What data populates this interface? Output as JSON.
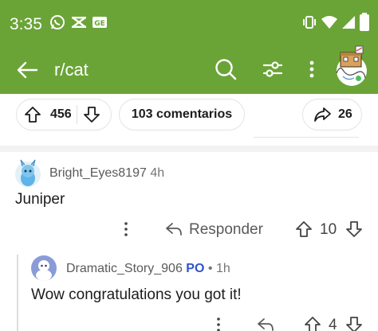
{
  "status_bar": {
    "time": "3:35",
    "icons": [
      "whatsapp-icon",
      "capcut-icon",
      "ge-badge-icon",
      "vibrate-icon",
      "wifi-icon",
      "signal-icon",
      "battery-icon"
    ]
  },
  "app_bar": {
    "title": "r/cat",
    "icons": [
      "back-arrow-icon",
      "search-icon",
      "filter-icon",
      "more-vertical-icon",
      "avatar"
    ]
  },
  "actions": {
    "upvotes": "456",
    "comments": "103 comentarios",
    "shares": "26"
  },
  "comments": [
    {
      "username": "Bright_Eyes8197",
      "age": "4h",
      "body": "Juniper",
      "reply_label": "Responder",
      "votes": "10"
    },
    {
      "username": "Dramatic_Story_906",
      "badge": "PO",
      "separator": "•",
      "age": "1h",
      "body": "Wow congratulations you got it!",
      "votes": "4"
    }
  ],
  "colors": {
    "brand_green": "#6aa436",
    "online_green": "#4cc160",
    "op_badge_blue": "#2f55c9",
    "text_gray": "#5a5a5a"
  }
}
